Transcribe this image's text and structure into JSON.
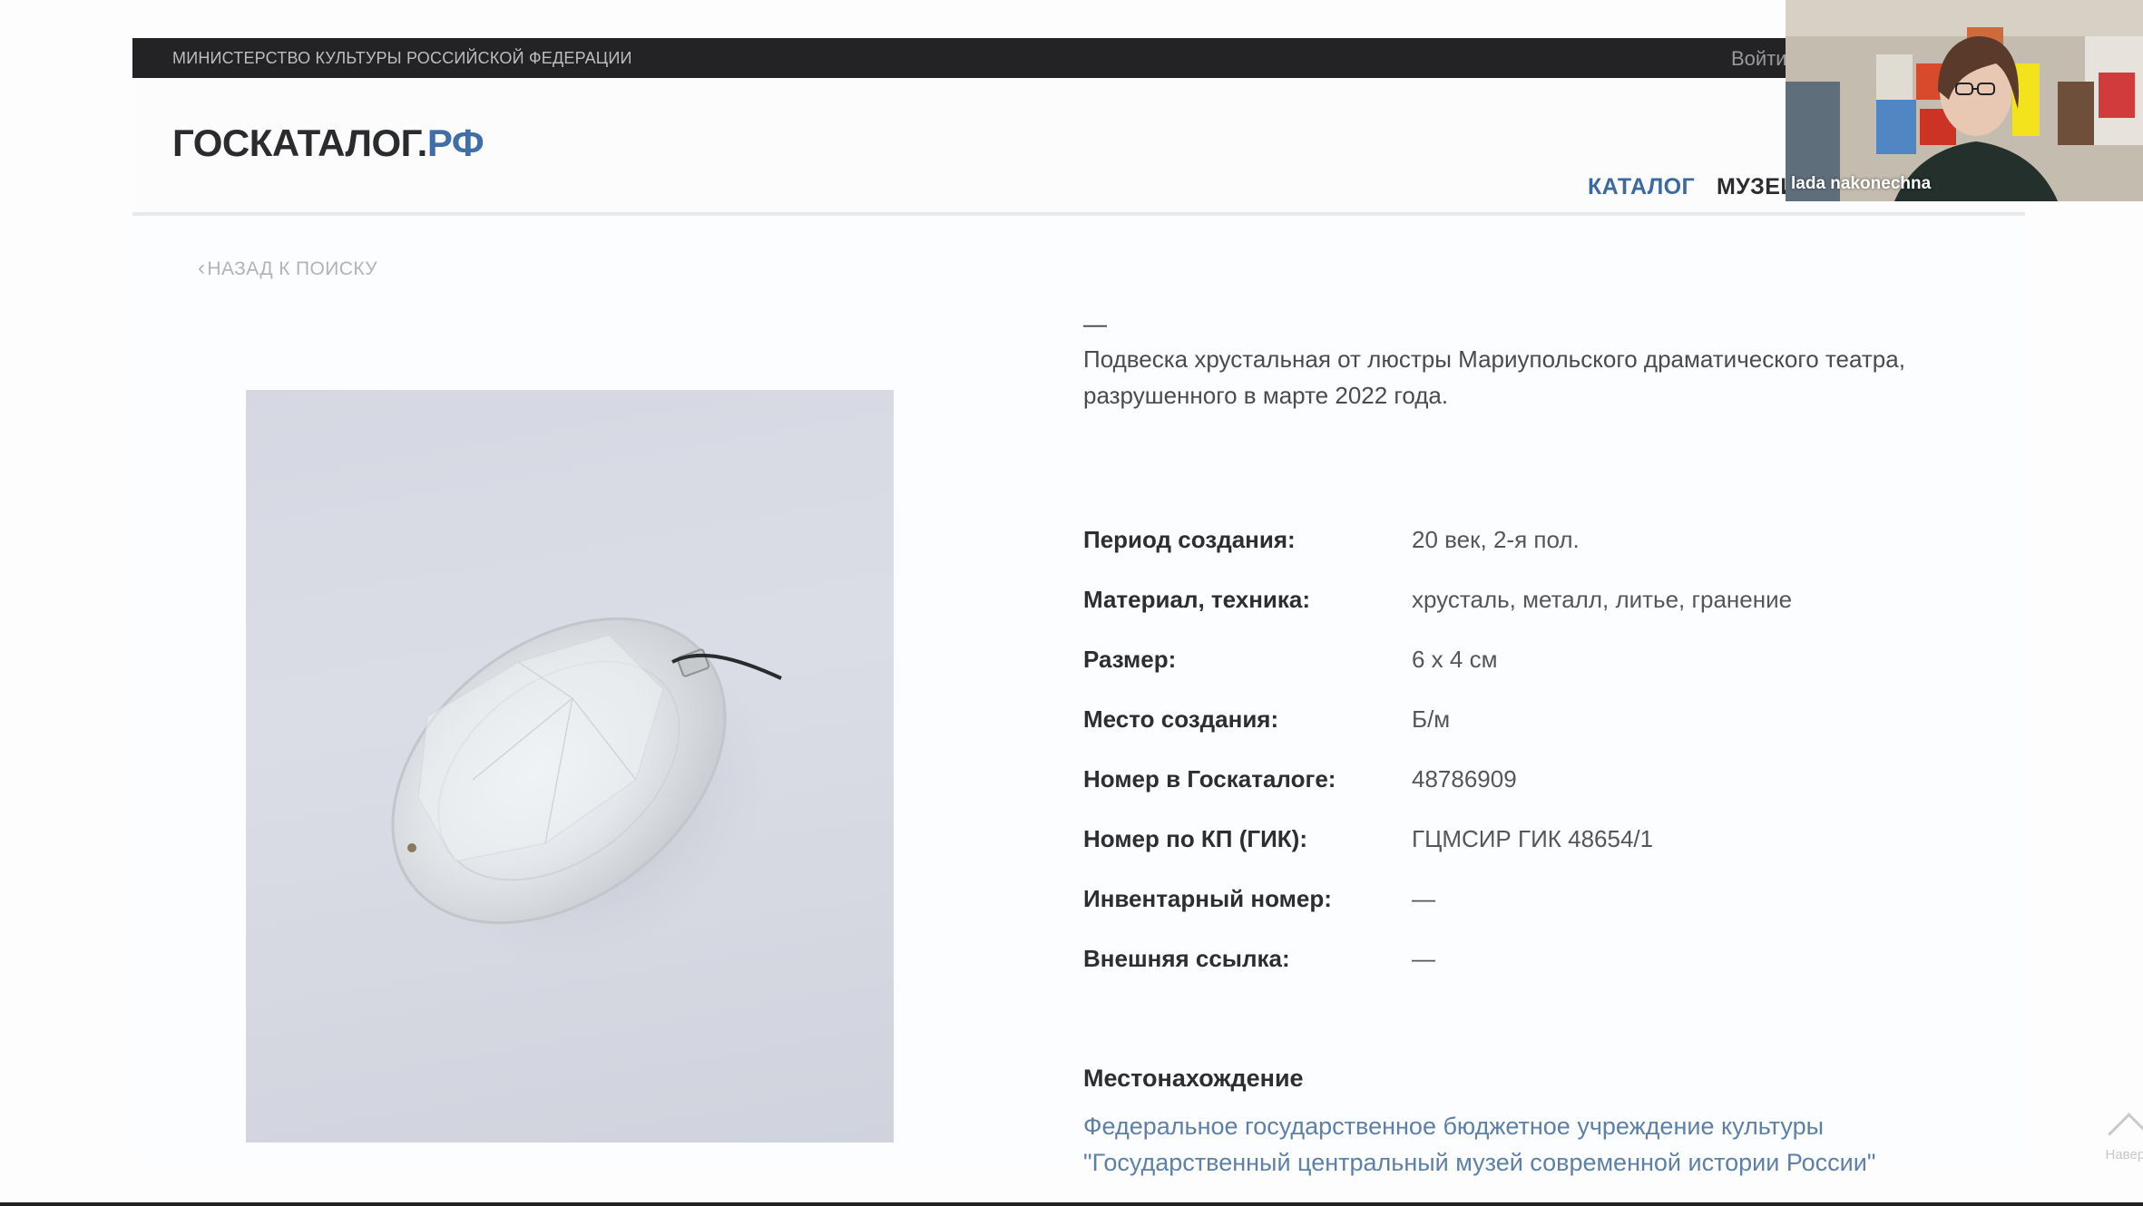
{
  "topbar": {
    "ministry": "МИНИСТЕРСТВО КУЛЬТУРЫ РОССИЙСКОЙ ФЕДЕРАЦИИ",
    "login": "Войти"
  },
  "header": {
    "logo_main": "ГОСКАТАЛОГ.",
    "logo_suffix": "РФ",
    "nav": {
      "catalog": "КАТАЛОГ",
      "museums": "МУЗЕИ"
    }
  },
  "back_link": "НАЗАД К ПОИСКУ",
  "object": {
    "dash": "—",
    "description": "Подвеска хрустальная от люстры Мариупольского драматического театра, разрушенного в марте 2022 года.",
    "properties": [
      {
        "label": "Период создания:",
        "value": "20 век, 2-я пол."
      },
      {
        "label": "Материал, техника:",
        "value": "хрусталь, металл, литье, гранение"
      },
      {
        "label": "Размер:",
        "value": "6 х 4 см"
      },
      {
        "label": "Место создания:",
        "value": "Б/м"
      },
      {
        "label": "Номер в Госкаталоге:",
        "value": "48786909"
      },
      {
        "label": "Номер по КП (ГИК):",
        "value": "ГЦМСИР ГИК 48654/1"
      },
      {
        "label": "Инвентарный номер:",
        "value": "—"
      },
      {
        "label": "Внешняя ссылка:",
        "value": "—"
      }
    ],
    "location_title": "Местонахождение",
    "location_link": "Федеральное государственное бюджетное учреждение культуры \"Государственный центральный музей современной истории России\""
  },
  "scroll_up": {
    "label": "Наверх"
  },
  "video": {
    "participant": "lada nakonechna"
  },
  "colors": {
    "accent_blue": "#3b6aa3",
    "link_blue": "#5d7fa8",
    "topbar_dark": "#232325"
  }
}
